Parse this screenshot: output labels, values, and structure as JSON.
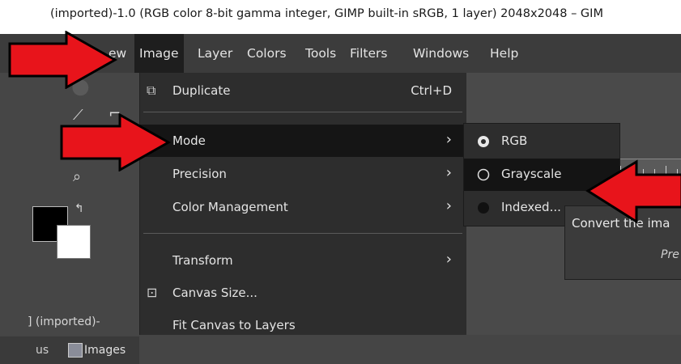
{
  "window": {
    "title": "(imported)-1.0 (RGB color 8-bit gamma integer, GIMP built-in sRGB, 1 layer) 2048x2048 – GIM"
  },
  "menubar": {
    "view_partial": "ew",
    "items": [
      "Image",
      "Layer",
      "Colors",
      "Tools",
      "Filters",
      "Windows",
      "Help"
    ]
  },
  "image_menu": {
    "duplicate": {
      "label": "Duplicate",
      "shortcut": "Ctrl+D"
    },
    "mode": {
      "label": "Mode"
    },
    "precision": {
      "label": "Precision"
    },
    "color_management": {
      "label": "Color Management"
    },
    "transform": {
      "label": "Transform"
    },
    "canvas_size": {
      "label": "Canvas Size..."
    },
    "fit_canvas": {
      "label": "Fit Canvas to Layers"
    },
    "submenu_arrow": "›"
  },
  "mode_menu": {
    "items": [
      {
        "label": "RGB",
        "state": "selected"
      },
      {
        "label": "Grayscale",
        "state": "unselected"
      },
      {
        "label": "Indexed...",
        "state": "unselected"
      }
    ]
  },
  "tooltip": {
    "text": "Convert the ima",
    "hint": "Pre"
  },
  "dock": {
    "tab_partial": "us",
    "images_tab": "Images",
    "row_label": "] (imported)-"
  },
  "colors": {
    "annotation_arrow": "#e8141b",
    "menu_bg": "#2d2d2d",
    "highlight": "#151515"
  }
}
